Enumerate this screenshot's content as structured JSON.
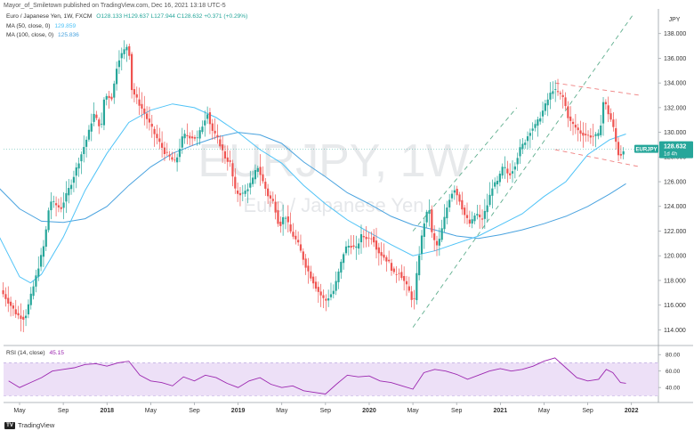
{
  "header": {
    "publisher": "Mayor_of_Smiletown published on TradingView.com, Dec 16, 2021 13:18 UTC-5"
  },
  "legend": {
    "main": "Euro / Japanese Yen, 1W, FXCM",
    "ohlc": "O128.133 H129.637 L127.944 C128.632 +0.371 (+0.29%)",
    "ma50_label": "MA (50, close, 0)",
    "ma50_value": "129.859",
    "ma100_label": "MA (100, close, 0)",
    "ma100_value": "125.836"
  },
  "watermark": {
    "symbol": "EURJPY, 1W",
    "name": "Euro / Japanese Yen"
  },
  "price_tag": {
    "symbol": "EURJPY",
    "price": "128.632",
    "countdown": "1d 4h"
  },
  "axis_currency": "JPY",
  "rsi": {
    "label": "RSI (14, close)",
    "value": "45.15"
  },
  "footer": {
    "brand": "TradingView",
    "logo_text": "TV"
  },
  "colors": {
    "up": "#26a69a",
    "down": "#ef5350",
    "ma50": "#4fc3f7",
    "ma100": "#4aa3df",
    "rsi_line": "#9c27b0",
    "rsi_band": "#e9d8f5",
    "channel_up": "#5fae8e",
    "wedge": "#ef7f7f",
    "price_tag": "#26a69a"
  },
  "chart_data": {
    "type": "candlestick",
    "title": "Euro / Japanese Yen, 1W, FXCM",
    "ylabel": "JPY",
    "ylim": [
      112.8,
      140
    ],
    "y_ticks": [
      114,
      116,
      118,
      120,
      122,
      124,
      126,
      128,
      130,
      132,
      134,
      136,
      138,
      140
    ],
    "x_ticks": [
      "May",
      "Sep",
      "2018",
      "May",
      "Sep",
      "2019",
      "May",
      "Sep",
      "2020",
      "May",
      "Sep",
      "2021",
      "May",
      "Sep",
      "2022"
    ],
    "x_tick_months": [
      0,
      4,
      8,
      12,
      16,
      20,
      24,
      28,
      32,
      36,
      40,
      44,
      48,
      52,
      56
    ],
    "price_path": [
      [
        -1.5,
        117.2
      ],
      [
        0.0,
        115.2
      ],
      [
        0.7,
        114.9
      ],
      [
        1.5,
        117.5
      ],
      [
        2.5,
        121.0
      ],
      [
        3.0,
        124.5
      ],
      [
        4.0,
        123.8
      ],
      [
        5.0,
        126.0
      ],
      [
        6.5,
        129.8
      ],
      [
        7.0,
        131.5
      ],
      [
        7.7,
        130.3
      ],
      [
        8.0,
        133.0
      ],
      [
        8.7,
        132.8
      ],
      [
        9.2,
        135.8
      ],
      [
        9.7,
        136.5
      ],
      [
        10.2,
        137.2
      ],
      [
        10.5,
        133.5
      ],
      [
        11.0,
        132.6
      ],
      [
        11.5,
        131.8
      ],
      [
        12.5,
        130.0
      ],
      [
        13.5,
        128.4
      ],
      [
        14.5,
        127.5
      ],
      [
        15.2,
        129.8
      ],
      [
        16.5,
        129.5
      ],
      [
        17.5,
        131.8
      ],
      [
        17.7,
        130.4
      ],
      [
        18.5,
        129.2
      ],
      [
        19.0,
        128.0
      ],
      [
        19.5,
        127.5
      ],
      [
        20.0,
        125.1
      ],
      [
        20.7,
        125.0
      ],
      [
        21.5,
        126.0
      ],
      [
        22.0,
        127.3
      ],
      [
        22.5,
        126.0
      ],
      [
        23.0,
        124.8
      ],
      [
        23.5,
        124.3
      ],
      [
        24.0,
        122.3
      ],
      [
        24.5,
        123.4
      ],
      [
        25.0,
        122.0
      ],
      [
        25.7,
        121.0
      ],
      [
        26.5,
        119.0
      ],
      [
        27.5,
        117.2
      ],
      [
        28.2,
        116.3
      ],
      [
        29.0,
        117.2
      ],
      [
        30.0,
        120.6
      ],
      [
        30.5,
        120.9
      ],
      [
        31.0,
        120.5
      ],
      [
        31.5,
        121.6
      ],
      [
        32.2,
        121.4
      ],
      [
        32.5,
        121.6
      ],
      [
        33.0,
        120.4
      ],
      [
        34.0,
        119.5
      ],
      [
        34.5,
        118.5
      ],
      [
        35.0,
        118.7
      ],
      [
        35.5,
        117.8
      ],
      [
        36.0,
        116.9
      ],
      [
        36.3,
        116.0
      ],
      [
        36.7,
        119.5
      ],
      [
        37.2,
        122.5
      ],
      [
        37.7,
        124.0
      ],
      [
        38.0,
        121.5
      ],
      [
        38.5,
        120.7
      ],
      [
        39.5,
        124.5
      ],
      [
        40.0,
        125.5
      ],
      [
        40.5,
        124.5
      ],
      [
        41.0,
        123.2
      ],
      [
        41.5,
        122.5
      ],
      [
        42.0,
        123.5
      ],
      [
        42.5,
        122.8
      ],
      [
        43.0,
        124.0
      ],
      [
        43.5,
        125.6
      ],
      [
        44.0,
        126.0
      ],
      [
        44.5,
        127.3
      ],
      [
        45.0,
        126.5
      ],
      [
        45.5,
        127.2
      ],
      [
        46.0,
        128.6
      ],
      [
        46.5,
        129.3
      ],
      [
        47.0,
        130.2
      ],
      [
        47.5,
        130.6
      ],
      [
        48.0,
        131.5
      ],
      [
        48.5,
        132.5
      ],
      [
        49.0,
        133.5
      ],
      [
        49.5,
        133.2
      ],
      [
        50.0,
        132.8
      ],
      [
        50.5,
        131.0
      ],
      [
        51.0,
        130.5
      ],
      [
        51.5,
        130.0
      ],
      [
        52.0,
        129.8
      ],
      [
        52.5,
        129.7
      ],
      [
        53.0,
        129.7
      ],
      [
        53.3,
        129.8
      ],
      [
        53.7,
        132.8
      ],
      [
        54.0,
        131.8
      ],
      [
        54.5,
        130.7
      ],
      [
        55.0,
        128.3
      ],
      [
        55.2,
        128.0
      ],
      [
        55.4,
        128.6
      ]
    ],
    "ma50_path": [
      [
        -2,
        121.8
      ],
      [
        0,
        118.3
      ],
      [
        1,
        117.8
      ],
      [
        2,
        118.5
      ],
      [
        4,
        121.5
      ],
      [
        6,
        125.3
      ],
      [
        8,
        128.3
      ],
      [
        10,
        130.8
      ],
      [
        12,
        131.8
      ],
      [
        14,
        132.3
      ],
      [
        16,
        132.0
      ],
      [
        18,
        131.2
      ],
      [
        20,
        130.0
      ],
      [
        22,
        128.6
      ],
      [
        24,
        127.5
      ],
      [
        26,
        125.7
      ],
      [
        28,
        124.2
      ],
      [
        30,
        122.9
      ],
      [
        32,
        121.9
      ],
      [
        34,
        120.9
      ],
      [
        36,
        120.0
      ],
      [
        38,
        120.4
      ],
      [
        40,
        121.0
      ],
      [
        42,
        121.6
      ],
      [
        44,
        122.5
      ],
      [
        46,
        123.4
      ],
      [
        48,
        124.8
      ],
      [
        50,
        126.0
      ],
      [
        52,
        128.2
      ],
      [
        54,
        129.4
      ],
      [
        55.5,
        129.86
      ]
    ],
    "ma100_path": [
      [
        -2,
        125.6
      ],
      [
        0,
        123.8
      ],
      [
        2,
        122.8
      ],
      [
        4,
        122.7
      ],
      [
        6,
        123.0
      ],
      [
        8,
        124.0
      ],
      [
        10,
        125.7
      ],
      [
        12,
        127.2
      ],
      [
        14,
        128.3
      ],
      [
        16,
        129.0
      ],
      [
        18,
        129.6
      ],
      [
        20,
        130.0
      ],
      [
        22,
        129.8
      ],
      [
        24,
        129.1
      ],
      [
        26,
        127.6
      ],
      [
        28,
        126.4
      ],
      [
        30,
        125.1
      ],
      [
        32,
        124.2
      ],
      [
        34,
        123.2
      ],
      [
        36,
        122.5
      ],
      [
        38,
        122.1
      ],
      [
        40,
        121.6
      ],
      [
        42,
        121.4
      ],
      [
        44,
        121.7
      ],
      [
        46,
        122.1
      ],
      [
        48,
        122.6
      ],
      [
        50,
        123.2
      ],
      [
        52,
        124.0
      ],
      [
        54,
        125.0
      ],
      [
        55.5,
        125.84
      ]
    ],
    "channel_lower": [
      [
        36.0,
        114.2
      ],
      [
        56.2,
        139.6
      ]
    ],
    "channel_upper": [
      [
        36.0,
        122.0
      ],
      [
        45.5,
        132.0
      ]
    ],
    "wedge_upper": [
      [
        49.0,
        134.0
      ],
      [
        56.8,
        133.0
      ]
    ],
    "wedge_lower": [
      [
        49.0,
        128.6
      ],
      [
        56.8,
        127.2
      ]
    ],
    "last_price": 128.632,
    "rsi": {
      "ylim": [
        25,
        90
      ],
      "ticks": [
        40,
        60,
        80
      ],
      "band": [
        30,
        70
      ],
      "path": [
        [
          -1,
          48
        ],
        [
          0,
          40
        ],
        [
          1,
          46
        ],
        [
          2,
          52
        ],
        [
          3,
          60
        ],
        [
          4,
          62
        ],
        [
          5,
          64
        ],
        [
          6,
          68
        ],
        [
          7,
          69
        ],
        [
          8,
          66
        ],
        [
          9,
          70
        ],
        [
          10,
          72
        ],
        [
          11,
          55
        ],
        [
          12,
          48
        ],
        [
          13,
          46
        ],
        [
          14,
          42
        ],
        [
          15,
          53
        ],
        [
          16,
          48
        ],
        [
          17,
          55
        ],
        [
          18,
          52
        ],
        [
          19,
          45
        ],
        [
          20,
          40
        ],
        [
          21,
          48
        ],
        [
          22,
          52
        ],
        [
          23,
          44
        ],
        [
          24,
          40
        ],
        [
          25,
          42
        ],
        [
          26,
          36
        ],
        [
          27,
          34
        ],
        [
          28,
          32
        ],
        [
          29,
          44
        ],
        [
          30,
          55
        ],
        [
          31,
          53
        ],
        [
          32,
          54
        ],
        [
          33,
          48
        ],
        [
          34,
          46
        ],
        [
          35,
          42
        ],
        [
          36,
          38
        ],
        [
          37,
          58
        ],
        [
          38,
          62
        ],
        [
          39,
          60
        ],
        [
          40,
          56
        ],
        [
          41,
          50
        ],
        [
          42,
          55
        ],
        [
          43,
          60
        ],
        [
          44,
          63
        ],
        [
          45,
          60
        ],
        [
          46,
          62
        ],
        [
          47,
          66
        ],
        [
          48,
          72
        ],
        [
          49,
          76
        ],
        [
          50,
          64
        ],
        [
          51,
          52
        ],
        [
          52,
          48
        ],
        [
          53,
          50
        ],
        [
          53.7,
          62
        ],
        [
          54.3,
          58
        ],
        [
          55,
          46
        ],
        [
          55.5,
          45.15
        ]
      ]
    }
  }
}
